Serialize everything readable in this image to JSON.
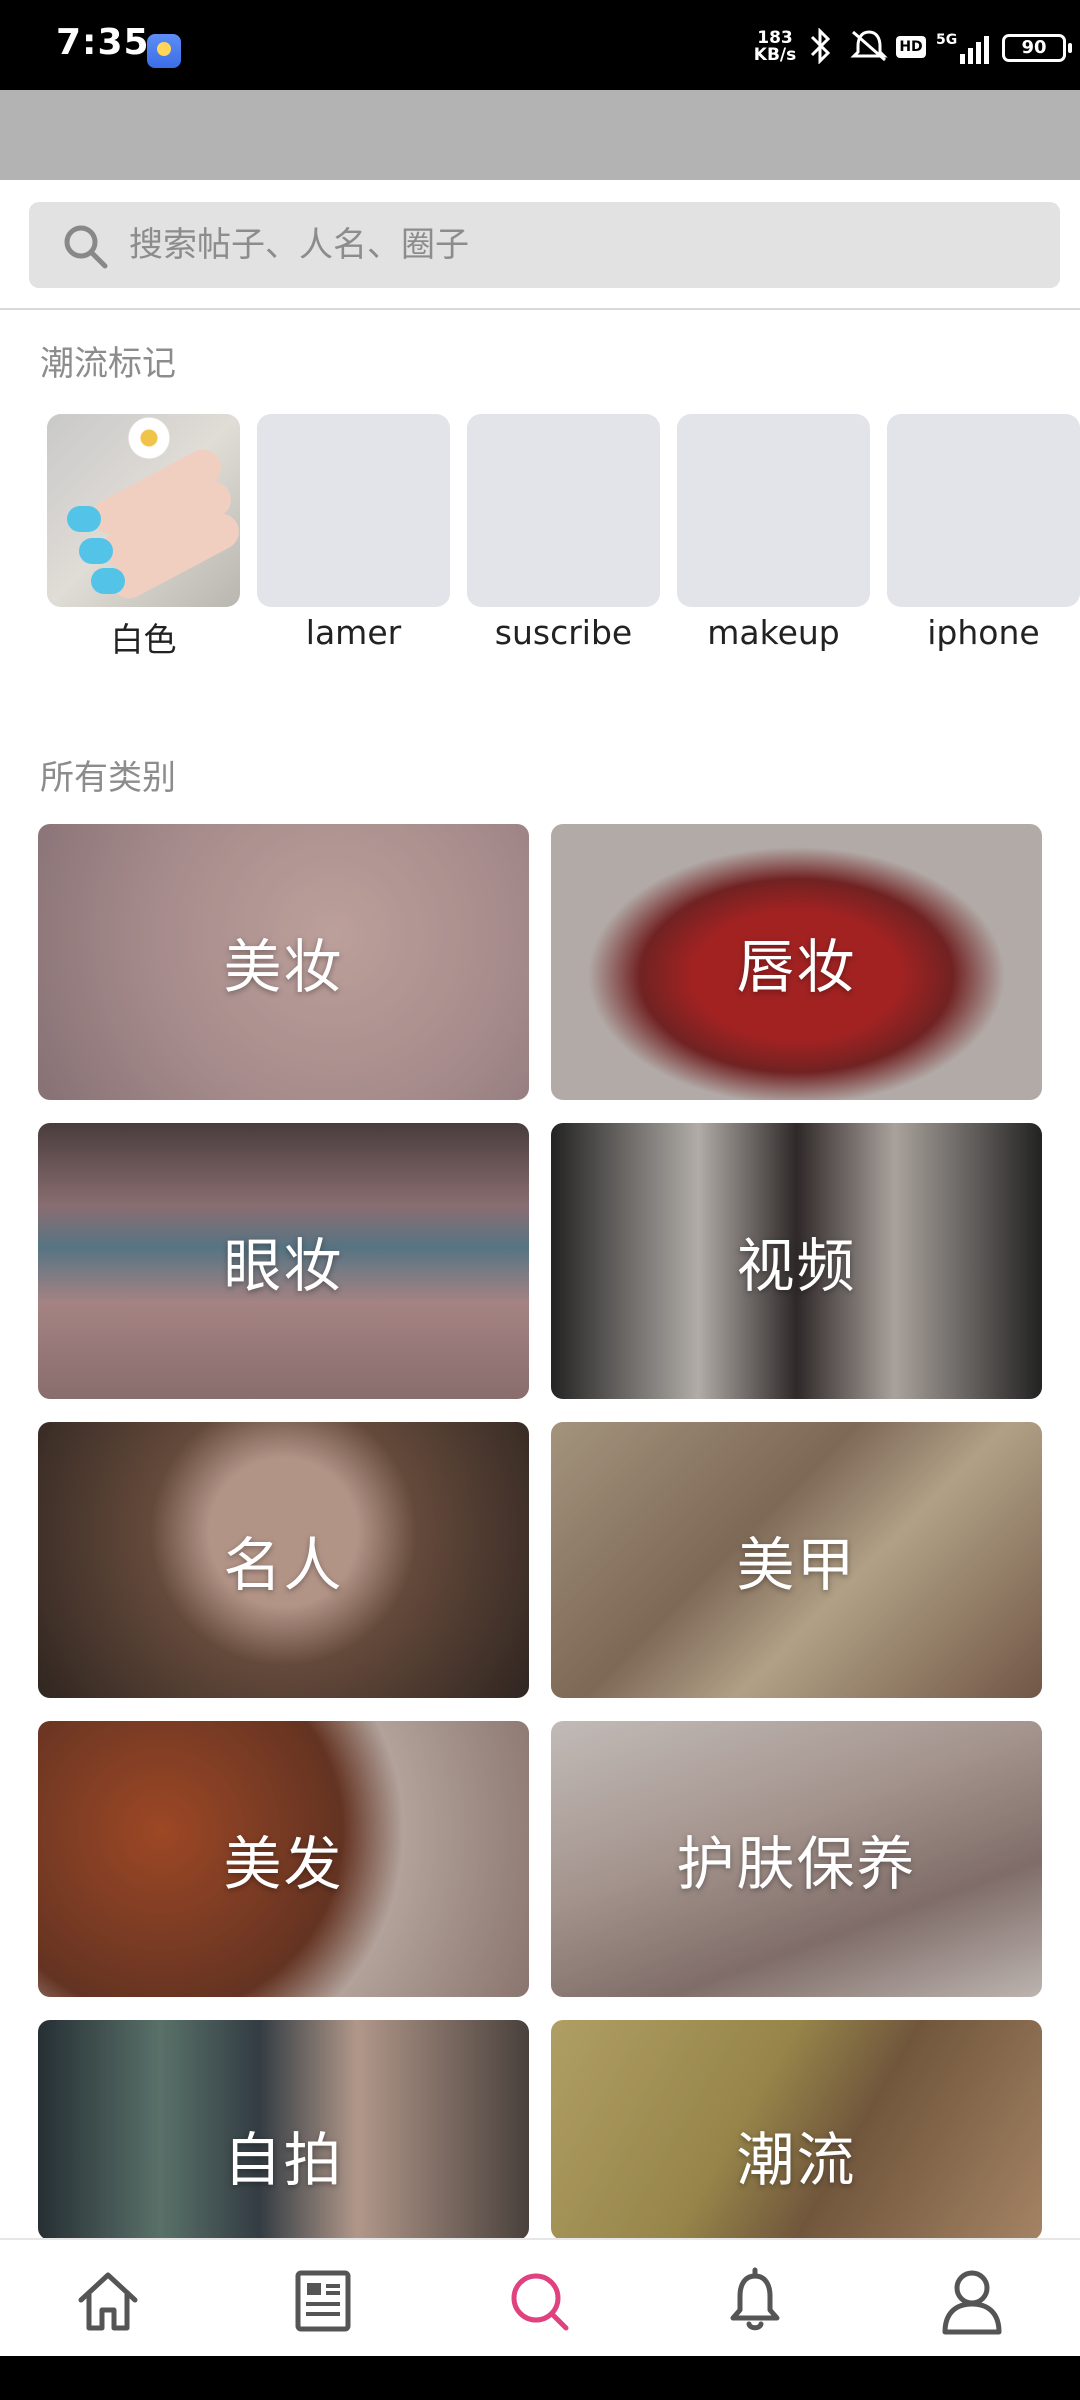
{
  "status_bar": {
    "time": "7:35",
    "net_speed_value": "183",
    "net_speed_unit": "KB/s",
    "network": "5G",
    "hd": "HD",
    "battery": "90"
  },
  "search": {
    "placeholder": "搜索帖子、人名、圈子"
  },
  "trending": {
    "title": "潮流标记",
    "items": [
      {
        "label": "白色",
        "thumb": "nail-photo"
      },
      {
        "label": "lamer",
        "thumb": "placeholder"
      },
      {
        "label": "suscribe",
        "thumb": "placeholder"
      },
      {
        "label": "makeup",
        "thumb": "placeholder"
      },
      {
        "label": "iphone",
        "thumb": "placeholder"
      }
    ]
  },
  "categories": {
    "title": "所有类别",
    "items": [
      {
        "label": "美妆",
        "tone": "#c9a9a9"
      },
      {
        "label": "唇妆",
        "tone": "#8a2a2a"
      },
      {
        "label": "眼妆",
        "tone": "#7a6a6e"
      },
      {
        "label": "视频",
        "tone": "#5a5050"
      },
      {
        "label": "名人",
        "tone": "#6b5245"
      },
      {
        "label": "美甲",
        "tone": "#9a7f6a"
      },
      {
        "label": "美发",
        "tone": "#7a3f2a"
      },
      {
        "label": "护肤保养",
        "tone": "#9c8580"
      },
      {
        "label": "自拍",
        "tone": "#3f4a52"
      },
      {
        "label": "潮流",
        "tone": "#b8a35a"
      }
    ]
  },
  "bottom_nav": {
    "items": [
      {
        "icon": "home-icon",
        "active": false
      },
      {
        "icon": "feed-icon",
        "active": false
      },
      {
        "icon": "search-icon",
        "active": true
      },
      {
        "icon": "bell-icon",
        "active": false
      },
      {
        "icon": "profile-icon",
        "active": false
      }
    ],
    "active_color": "#e0427f",
    "inactive_color": "#555555"
  }
}
